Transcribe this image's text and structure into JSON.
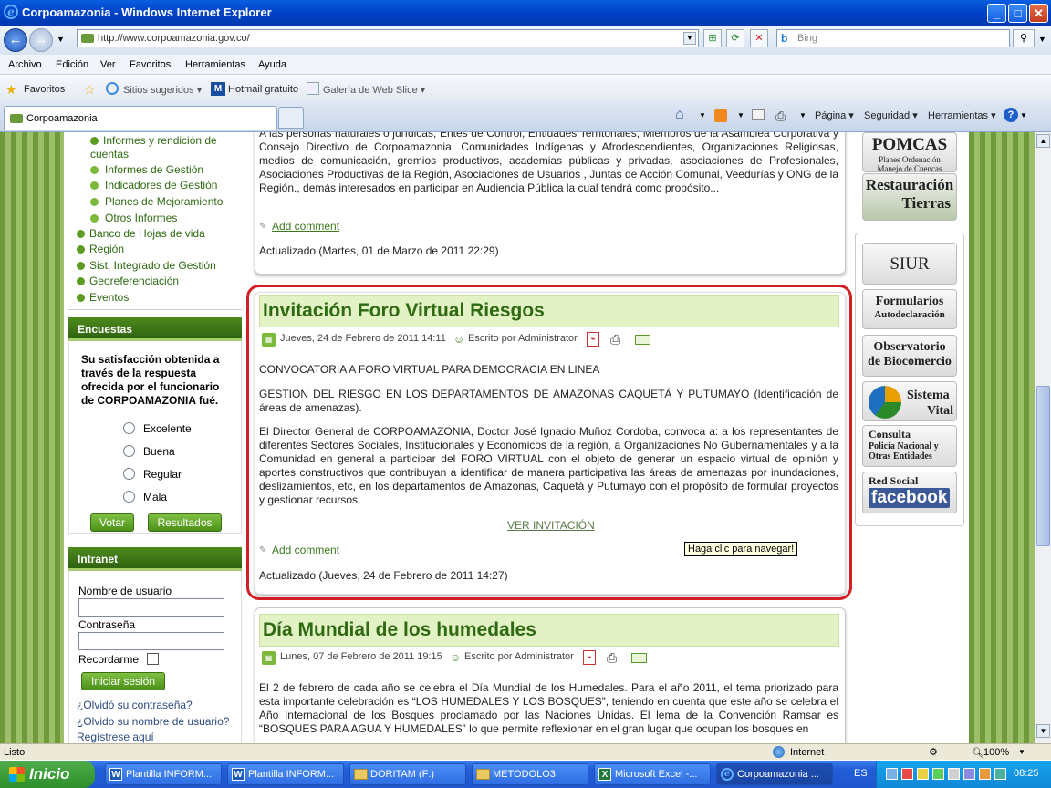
{
  "window": {
    "title": "Corpoamazonia - Windows Internet Explorer",
    "minimize": "_",
    "maximize": "□",
    "close": "✕"
  },
  "address": {
    "url": "http://www.corpoamazonia.gov.co/",
    "search_placeholder": "Bing"
  },
  "menu": [
    "Archivo",
    "Edición",
    "Ver",
    "Favoritos",
    "Herramientas",
    "Ayuda"
  ],
  "favbar": {
    "favorites": "Favoritos",
    "suggested": "Sitios sugeridos ▾",
    "hotmail": "Hotmail gratuito",
    "webslice": "Galería de Web Slice ▾"
  },
  "tabs": {
    "active": "Corpoamazonia"
  },
  "commandbar": {
    "page": "Página ▾",
    "security": "Seguridad ▾",
    "tools": "Herramientas ▾"
  },
  "sidebar": {
    "links": [
      "Informes y rendición de",
      "cuentas",
      "Informes de Gestión",
      "Indicadores de Gestión",
      "Planes de Mejoramiento",
      "Otros Informes",
      "Banco de Hojas de vida",
      "Región",
      "Sist. Integrado de Gestión",
      "Georeferenciación",
      "Eventos"
    ],
    "poll": {
      "header": "Encuestas",
      "question": [
        "Su satisfacción obtenida a",
        "través de la respuesta",
        "ofrecida por el funcionario",
        "de CORPOAMAZONIA fué."
      ],
      "options": [
        "Excelente",
        "Buena",
        "Regular",
        "Mala"
      ],
      "vote": "Votar",
      "results": "Resultados"
    },
    "intranet": {
      "header": "Intranet",
      "username_label": "Nombre de usuario",
      "password_label": "Contraseña",
      "remember": "Recordarme",
      "login": "Iniciar sesión",
      "forgot_password": "¿Olvidó su contraseña?",
      "forgot_user": "¿Olvido su nombre de usuario?",
      "register": "Regístrese aquí"
    }
  },
  "articles": {
    "prev": {
      "text": "A las personas naturales o jurídicas, Entes de Control, Entidades Territoriales, Miembros de la Asamblea Corporativa y Consejo Directivo de Corpoamazonia, Comunidades Indígenas y Afrodescendientes, Organizaciones Religiosas, medios de comunicación, gremios productivos, academias públicas y privadas, asociaciones de Profesionales, Asociaciones Productivas de la Región, Asociaciones de Usuarios , Juntas de Acción Comunal, Veedurías y ONG de la Región., demás interesados en participar en Audiencia Pública la cual tendrá como propósito...",
      "add_comment": "Add comment",
      "updated": "Actualizado (Martes, 01 de Marzo de 2011 22:29)"
    },
    "main": {
      "title": "Invitación Foro Virtual Riesgos",
      "date": "Jueves, 24 de Febrero de 2011 14:11",
      "author": "Escrito por Administrator",
      "p1": "CONVOCATORIA A FORO VIRTUAL PARA DEMOCRACIA EN LINEA",
      "p2": "GESTION DEL RIESGO EN LOS DEPARTAMENTOS DE AMAZONAS CAQUETÁ Y PUTUMAYO (Identificación de áreas de amenazas).",
      "p3": "El Director General de CORPOAMAZONIA, Doctor José Ignacio Muñoz Cordoba, convoca a: a los representantes de diferentes Sectores Sociales, Institucionales y Económicos de la región, a Organizaciones No Gubernamentales y a la Comunidad en general a participar del FORO VIRTUAL con el objeto de generar un espacio virtual de opinión y aportes constructivos que contribuyan a identificar de manera participativa las áreas de amenazas por inundaciones, deslizamientos, etc, en los departamentos de Amazonas, Caquetá y Putumayo con el propósito de formular proyectos y gestionar recursos.",
      "link": "VER INVITACIÓN",
      "tooltip": "Haga clic para navegar!",
      "add_comment": "Add comment",
      "updated": "Actualizado (Jueves, 24 de Febrero de 2011 14:27)"
    },
    "next": {
      "title": "Día Mundial de los humedales",
      "date": "Lunes, 07 de Febrero de 2011 19:15",
      "author": "Escrito por Administrator",
      "text": "El 2 de febrero de cada año se celebra el Día Mundial de los Humedales. Para el año 2011, el tema priorizado para esta importante celebración es “LOS HUMEDALES Y LOS BOSQUES”, teniendo en cuenta que este año se celebra el Año Internacional de los Bosques proclamado por las Naciones Unidas. El lema de la Convención Ramsar es “BOSQUES PARA AGUA Y HUMEDALES” lo que permite reflexionar en el gran lugar que ocupan los bosques en"
    }
  },
  "right": {
    "pomcas": "POMCAS",
    "pomcas_sub": [
      "Planes Ordenación",
      "Manejo de Cuencas"
    ],
    "restauracion": "Restauración",
    "tierras": "Tierras",
    "siur": "SIUR",
    "formularios": "Formularios",
    "autodeclaracion": "Autodeclaración",
    "observatorio": "Observatorio",
    "biocomercio": "de Biocomercio",
    "sistema": "Sistema",
    "vital": "Vital",
    "consulta": "Consulta",
    "policia": "Policía Nacional y",
    "otras": "Otras Entidades",
    "red_social": "Red Social",
    "facebook": "facebook"
  },
  "status": {
    "left": "Listo",
    "zone": "Internet",
    "zoom": "100%"
  },
  "taskbar": {
    "start": "Inicio",
    "items": [
      "Plantilla INFORM...",
      "Plantilla INFORM...",
      "DORITAM (F:)",
      "METODOLO3",
      "Microsoft Excel -...",
      "Corpoamazonia ..."
    ],
    "lang": "ES",
    "clock": "08:25"
  }
}
